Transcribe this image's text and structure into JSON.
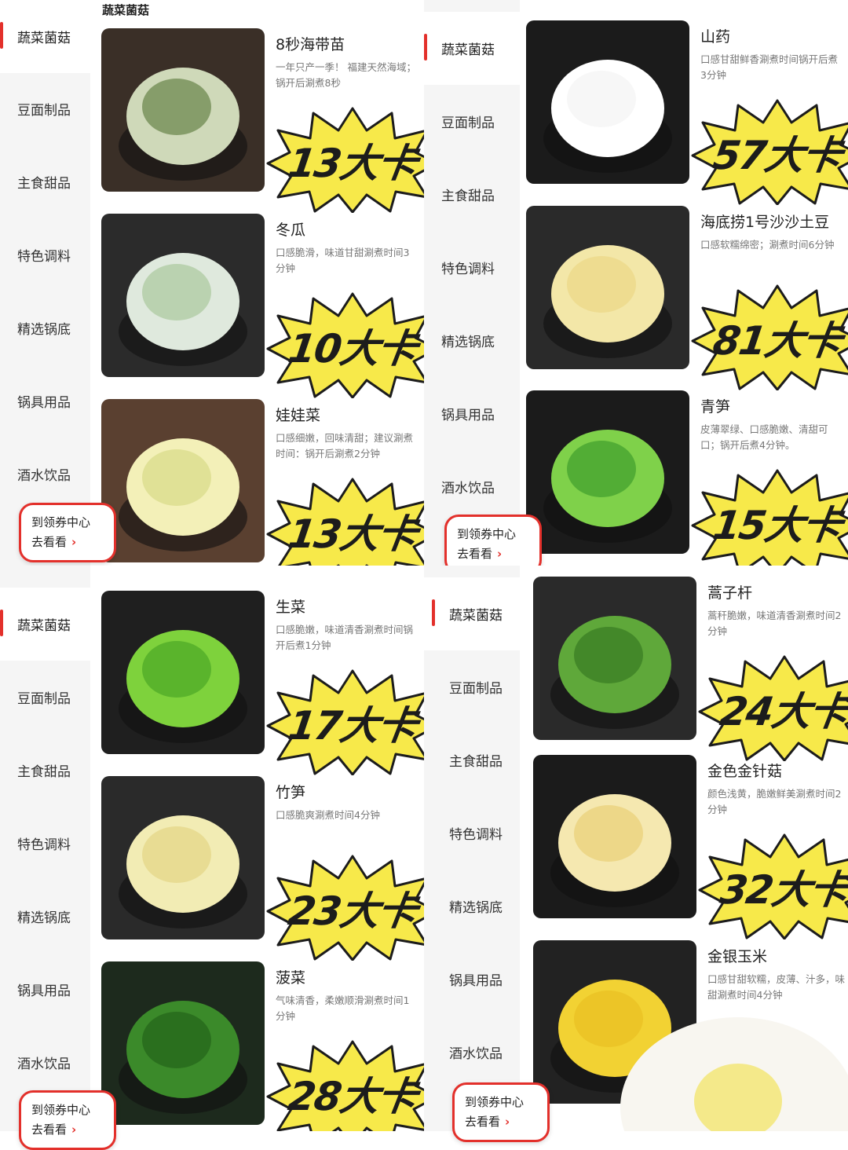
{
  "sidebar_items": [
    "蔬菜菌菇",
    "豆面制品",
    "主食甜品",
    "特色调料",
    "精选锅底",
    "锅具用品",
    "酒水饮品"
  ],
  "section_title": "蔬菜菌菇",
  "coupon": {
    "line1": "到领券中心",
    "line2": "去看看"
  },
  "price_mark": "¥",
  "panels": [
    {
      "items": [
        {
          "name": "8秒海带苗",
          "desc": "一年只产一季！ 福建天然海域；锅开后涮煮8秒",
          "cal": "13大卡"
        },
        {
          "name": "冬瓜",
          "desc": "口感脆滑，味道甘甜涮煮时间3分钟",
          "cal": "10大卡"
        },
        {
          "name": "娃娃菜",
          "desc": "口感细嫩，回味清甜；建议涮煮时间：锅开后涮煮2分钟",
          "cal": "13大卡"
        }
      ]
    },
    {
      "items": [
        {
          "name": "山药",
          "desc": "口感甘甜鲜香涮煮时间锅开后煮3分钟",
          "cal": "57大卡"
        },
        {
          "name": "海底捞1号沙沙土豆",
          "desc": "口感软糯绵密；涮煮时间6分钟",
          "cal": "81大卡"
        },
        {
          "name": "青笋",
          "desc": "皮薄翠绿、口感脆嫩、清甜可口；锅开后煮4分钟。",
          "cal": "15大卡"
        }
      ]
    },
    {
      "items": [
        {
          "name": "生菜",
          "desc": "口感脆嫩，味道清香涮煮时间锅开后煮1分钟",
          "cal": "17大卡"
        },
        {
          "name": "竹笋",
          "desc": "口感脆爽涮煮时间4分钟",
          "cal": "23大卡"
        },
        {
          "name": "菠菜",
          "desc": "气味清香，柔嫩顺滑涮煮时间1分钟",
          "cal": "28大卡"
        }
      ]
    },
    {
      "items": [
        {
          "name": "蒿子杆",
          "desc": "蒿秆脆嫩，味道清香涮煮时间2分钟",
          "cal": "24大卡"
        },
        {
          "name": "金色金针菇",
          "desc": "颜色浅黄，脆嫩鲜美涮煮时间2分钟",
          "cal": "32大卡"
        },
        {
          "name": "金银玉米",
          "desc": "口感甘甜软糯，皮薄、汁多，味甜涮煮时间4分钟",
          "cal": ""
        }
      ]
    }
  ],
  "colors": {
    "accent": "#e3302b",
    "burst": "#f7e94a",
    "sidebar_bg": "#f5f5f5"
  }
}
